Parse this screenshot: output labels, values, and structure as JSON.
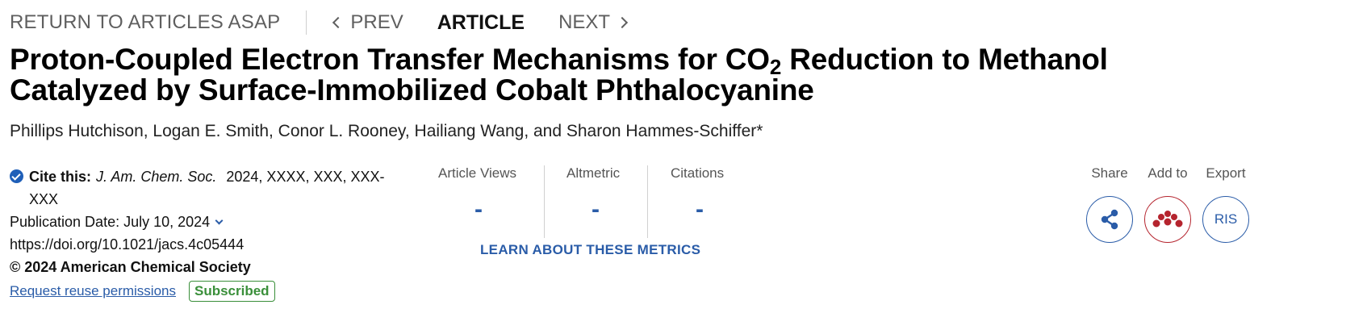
{
  "nav": {
    "return_label": "RETURN TO ARTICLES ASAP",
    "prev_label": "PREV",
    "current_label": "ARTICLE",
    "next_label": "NEXT"
  },
  "article": {
    "title_part1": "Proton-Coupled Electron Transfer Mechanisms for CO",
    "title_sub": "2",
    "title_part2": " Reduction to Methanol Catalyzed by Surface-Immobilized Cobalt Phthalocyanine",
    "authors": "Phillips Hutchison, Logan E. Smith, Conor L. Rooney, Hailiang Wang, and Sharon Hammes-Schiffer*"
  },
  "citation": {
    "cite_label": "Cite this:",
    "journal": "J. Am. Chem. Soc.",
    "details": "2024, XXXX, XXX, XXX-XXX",
    "publication_date": "Publication Date: July 10, 2024",
    "doi": "https://doi.org/10.1021/jacs.4c05444",
    "copyright": "© 2024 American Chemical Society",
    "reuse_link": "Request reuse permissions",
    "access_badge": "Subscribed"
  },
  "metrics": {
    "views_label": "Article Views",
    "views_value": "-",
    "altmetric_label": "Altmetric",
    "altmetric_value": "-",
    "citations_label": "Citations",
    "citations_value": "-",
    "learn_link": "LEARN ABOUT THESE METRICS"
  },
  "actions": {
    "share_label": "Share",
    "add_label": "Add to",
    "export_label": "Export",
    "export_button": "RIS",
    "share_icon": "share-icon",
    "add_icon": "mendeley-icon"
  },
  "colors": {
    "link_blue": "#2a5ca8",
    "mendeley_red": "#b5242e",
    "subscribed_green": "#3a8f3a"
  }
}
